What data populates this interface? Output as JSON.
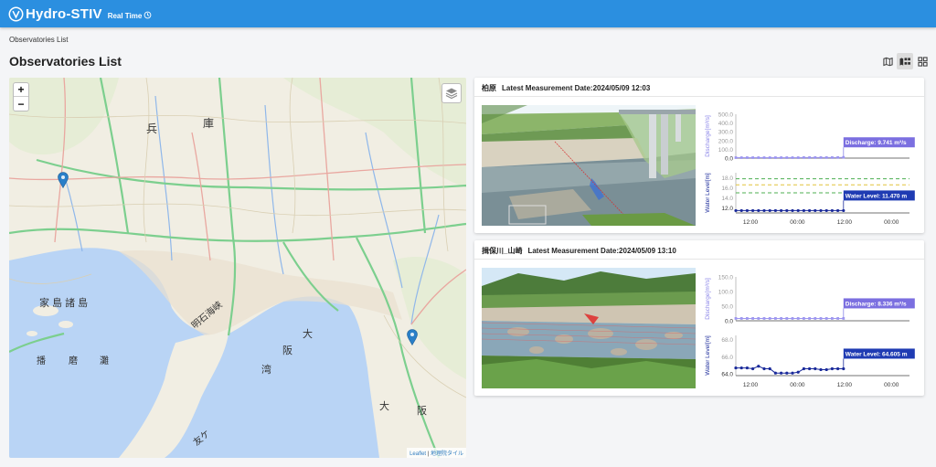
{
  "app": {
    "name": "Hydro-STIV",
    "subtitle": "Real Time"
  },
  "breadcrumb": "Observatories List",
  "page_title": "Observatories List",
  "view_modes": [
    "map-view-icon",
    "map-list-view-icon",
    "grid-view-icon"
  ],
  "map": {
    "zoom_in": "+",
    "zoom_out": "−",
    "attribution_leaflet": "Leaflet",
    "attribution_sep": " | ",
    "attribution_tiles": "地理院タイル",
    "place_labels": [
      "兵",
      "庫",
      "家 島 諸 島",
      "播",
      "磨",
      "灘",
      "明石海峡",
      "大",
      "阪",
      "湾",
      "阪",
      "大",
      "友ケ"
    ],
    "colors": {
      "sea": "#b9d4f5",
      "land": "#f1eee3",
      "road": "#7ccf8e",
      "marker": "#2a7fc8"
    }
  },
  "stations": [
    {
      "name": "柏原",
      "latest_label": "Latest Measurement Date:2024/05/09 12:03",
      "chart_data": [
        {
          "type": "line",
          "ylabel": "Discharge[m³/s]",
          "yticks": [
            "500.0",
            "400.0",
            "300.0",
            "200.0",
            "100.0",
            "0.0"
          ],
          "ylim": [
            0,
            500
          ],
          "x_ticks": [
            "12:00",
            "00:00",
            "12:00",
            "00:00"
          ],
          "series": [
            {
              "values": [
                5,
                5,
                5,
                5,
                5,
                5,
                5,
                5,
                5,
                5,
                5,
                5,
                6,
                6,
                6,
                6,
                6,
                6,
                7,
                8
              ]
            }
          ],
          "callout": "Discharge: 9.741 m³/s"
        },
        {
          "type": "line",
          "ylabel": "Water Level[m]",
          "yticks": [
            "18.0",
            "16.0",
            "14.0",
            "12.0"
          ],
          "ylim": [
            11,
            19
          ],
          "x_ticks": [
            "12:00",
            "00:00",
            "12:00",
            "00:00"
          ],
          "series": [
            {
              "values": [
                11.47,
                11.47,
                11.47,
                11.47,
                11.47,
                11.47,
                11.47,
                11.47,
                11.47,
                11.47,
                11.47,
                11.47,
                11.47,
                11.47,
                11.47,
                11.47,
                11.47,
                11.47,
                11.47,
                11.47
              ]
            }
          ],
          "thresholds": [
            {
              "value": 17.8,
              "color": "#4caf50"
            },
            {
              "value": 16.6,
              "color": "#e0c43a"
            },
            {
              "value": 15.0,
              "color": "#4caf50"
            }
          ],
          "callout": "Water Level: 11.470 m"
        }
      ]
    },
    {
      "name": "揖保川_山崎",
      "latest_label": "Latest Measurement Date:2024/05/09 13:10",
      "chart_data": [
        {
          "type": "line",
          "ylabel": "Discharge[m³/s]",
          "yticks": [
            "150.0",
            "100.0",
            "50.0",
            "0.0"
          ],
          "ylim": [
            0,
            150
          ],
          "x_ticks": [
            "12:00",
            "00:00",
            "12:00",
            "00:00"
          ],
          "series": [
            {
              "values": [
                8,
                8,
                8,
                8,
                8,
                8,
                8,
                8,
                8,
                8,
                8,
                8,
                8,
                8,
                8,
                8,
                8,
                8,
                8,
                8
              ]
            }
          ],
          "callout": "Discharge: 8.336 m³/s"
        },
        {
          "type": "line",
          "ylabel": "Water Level[m]",
          "yticks": [
            "68.0",
            "66.0",
            "64.0"
          ],
          "ylim": [
            63.8,
            68.5
          ],
          "x_ticks": [
            "12:00",
            "00:00",
            "12:00",
            "00:00"
          ],
          "series": [
            {
              "values": [
                64.7,
                64.7,
                64.7,
                64.6,
                64.9,
                64.6,
                64.6,
                64.1,
                64.1,
                64.1,
                64.1,
                64.2,
                64.6,
                64.6,
                64.6,
                64.5,
                64.5,
                64.6,
                64.6,
                64.605
              ]
            }
          ],
          "callout": "Water Level: 64.605 m"
        }
      ]
    }
  ]
}
